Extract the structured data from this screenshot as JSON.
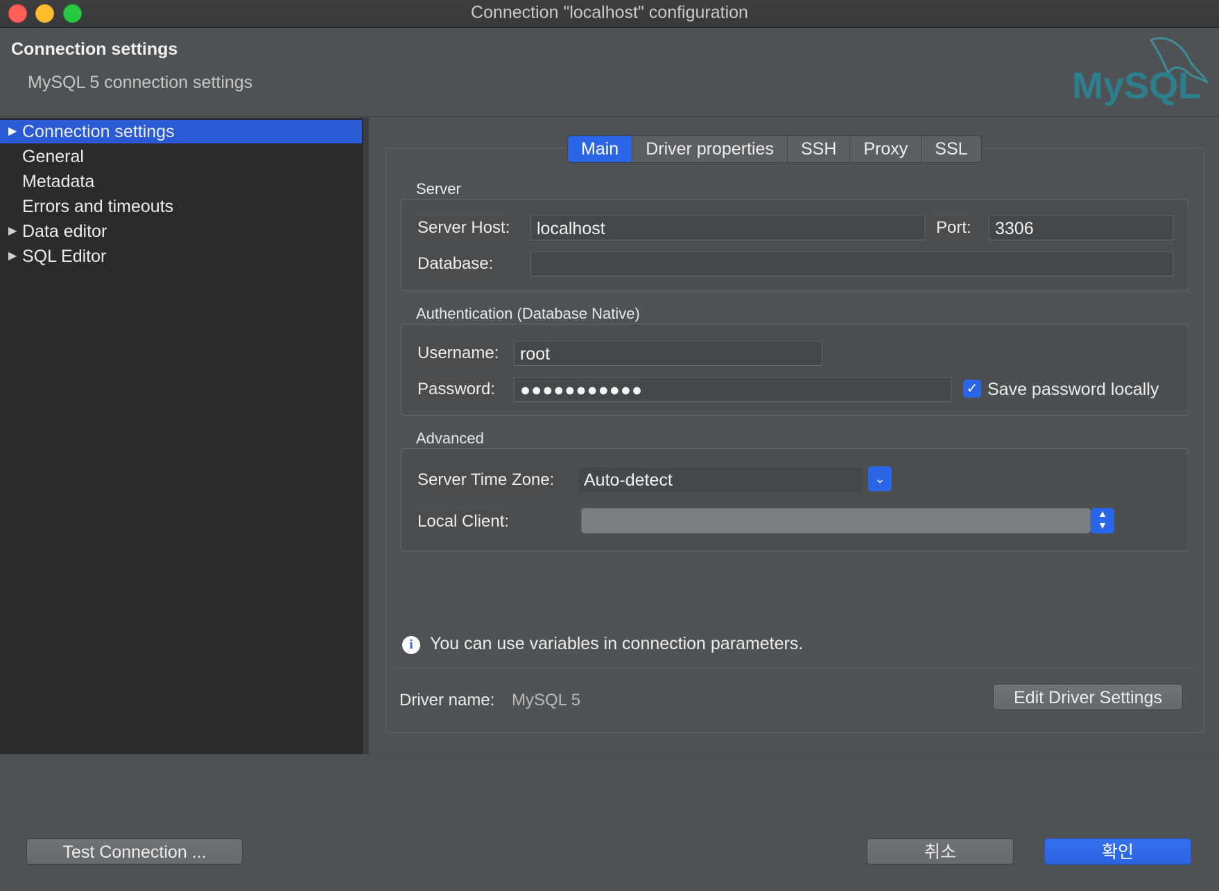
{
  "window": {
    "title": "Connection \"localhost\" configuration",
    "controls": [
      "close",
      "minimize",
      "zoom"
    ]
  },
  "header": {
    "title": "Connection settings",
    "subtitle": "MySQL 5 connection settings",
    "logo_text": "MySQL"
  },
  "tree": {
    "items": [
      {
        "label": "Connection settings",
        "selected": true,
        "expandable": true
      },
      {
        "label": "General",
        "selected": false,
        "expandable": false
      },
      {
        "label": "Metadata",
        "selected": false,
        "expandable": false
      },
      {
        "label": "Errors and timeouts",
        "selected": false,
        "expandable": false
      },
      {
        "label": "Data editor",
        "selected": false,
        "expandable": true
      },
      {
        "label": "SQL Editor",
        "selected": false,
        "expandable": true
      }
    ]
  },
  "tabs": [
    {
      "label": "Main",
      "active": true
    },
    {
      "label": "Driver properties",
      "active": false
    },
    {
      "label": "SSH",
      "active": false
    },
    {
      "label": "Proxy",
      "active": false
    },
    {
      "label": "SSL",
      "active": false
    }
  ],
  "server": {
    "group_label": "Server",
    "host_label": "Server Host:",
    "host_value": "localhost",
    "port_label": "Port:",
    "port_value": "3306",
    "database_label": "Database:",
    "database_value": ""
  },
  "auth": {
    "group_label": "Authentication (Database Native)",
    "username_label": "Username:",
    "username_value": "root",
    "password_label": "Password:",
    "password_value": "●●●●●●●●●●●",
    "save_password_label": "Save password locally",
    "save_password_checked": true
  },
  "advanced": {
    "group_label": "Advanced",
    "timezone_label": "Server Time Zone:",
    "timezone_value": "Auto-detect",
    "local_client_label": "Local Client:",
    "local_client_value": ""
  },
  "info": {
    "text": "You can use variables in connection parameters."
  },
  "driver": {
    "label": "Driver name:",
    "value": "MySQL 5",
    "edit_button": "Edit Driver Settings"
  },
  "footer": {
    "test_button": "Test Connection ...",
    "cancel_button": "취소",
    "ok_button": "확인"
  },
  "colors": {
    "accent": "#2b65e8",
    "tree_background": "#2b2b2b",
    "dialog_background": "#4f5254"
  }
}
